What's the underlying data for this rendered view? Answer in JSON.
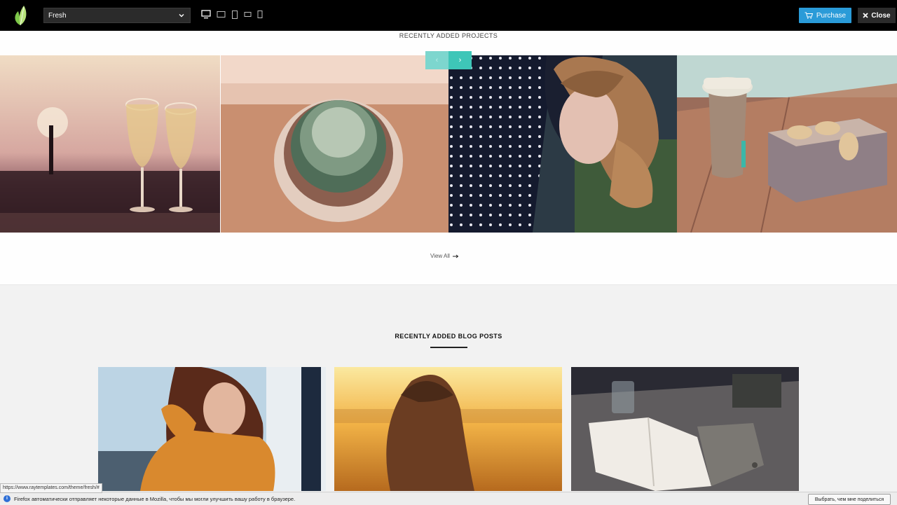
{
  "topbar": {
    "theme_selected": "Fresh",
    "devices": [
      "desktop-icon",
      "laptop-icon",
      "tablet-portrait-icon",
      "tablet-landscape-icon",
      "phone-icon"
    ],
    "purchase_label": "Purchase",
    "close_label": "Close",
    "purchase_color": "#2a9bd8"
  },
  "projects": {
    "title": "RECENTLY ADDED PROJECTS",
    "prev_icon": "‹",
    "next_icon": "›",
    "view_all_label": "View All",
    "accent_color": "#3ec6b8"
  },
  "blog": {
    "title": "RECENTLY ADDED BLOG POSTS"
  },
  "browser": {
    "status_url": "https://www.raytemplates.com/theme/fresh/#",
    "notification_text": "Firefox автоматически отправляет некоторые данные в Mozilla, чтобы мы могли улучшить вашу работу в браузере.",
    "notification_button": "Выбрать, чем мне поделиться"
  }
}
